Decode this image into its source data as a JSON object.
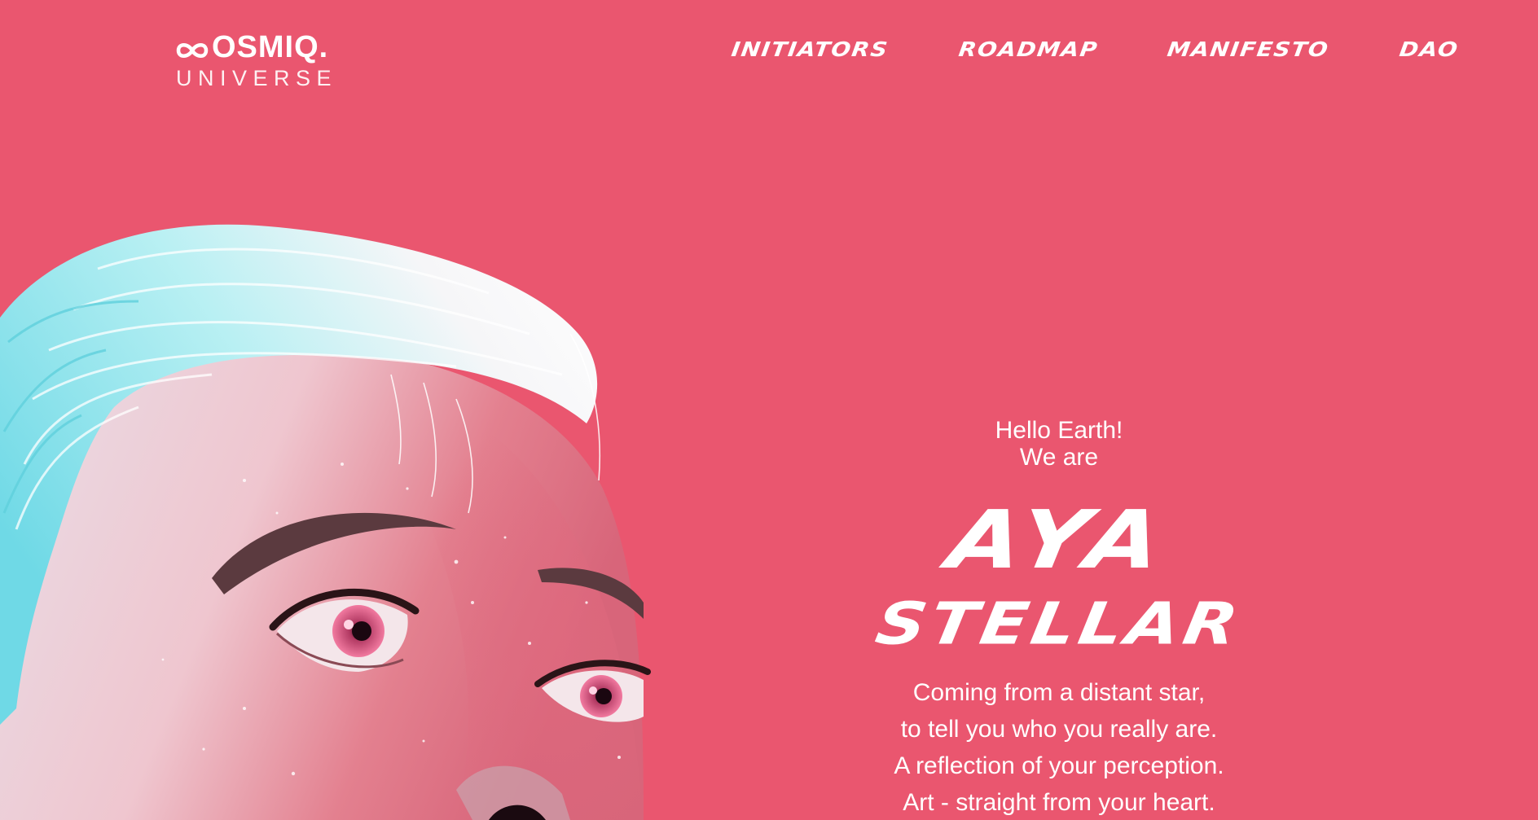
{
  "brand": {
    "logo_top": "OSMIQ.",
    "logo_bottom": "UNIVERSE"
  },
  "nav": {
    "items": [
      {
        "label": "INITIATORS"
      },
      {
        "label": "ROADMAP"
      },
      {
        "label": "MANIFESTO"
      },
      {
        "label": "DAO"
      }
    ]
  },
  "hero": {
    "greeting_line1": "Hello Earth!",
    "greeting_line2": "We are",
    "title_line1": "AYA",
    "title_line2": "STELLAR",
    "description": [
      "Coming from a distant star,",
      "to tell you who you really are.",
      "A reflection of your perception.",
      "Art - straight from your heart."
    ]
  },
  "colors": {
    "background": "#ea566f",
    "text": "#ffffff",
    "hair": "#7fe0ea",
    "skin": "#f0c7d0"
  },
  "icons": {
    "logo_mark": "infinity-icon"
  }
}
